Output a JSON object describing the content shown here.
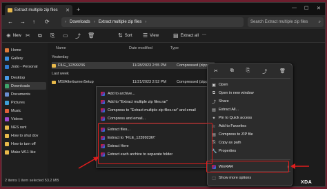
{
  "window": {
    "tab_title": "Extract multiple zip files",
    "tab_close": "✕",
    "new_tab": "+",
    "minimize": "—",
    "maximize": "☐",
    "close": "✕"
  },
  "address": {
    "back": "←",
    "forward": "→",
    "up": "↑",
    "refresh": "⟳",
    "crumbs": [
      "Downloads",
      "Extract multiple zip files"
    ],
    "sep": "›",
    "more": "⋯",
    "search_placeholder": "Search Extract multiple zip files",
    "search_icon": "⌕"
  },
  "toolbar": {
    "new_label": "New",
    "sort_label": "Sort",
    "view_label": "View",
    "extract_all_label": "Extract all",
    "more": "⋯"
  },
  "sidebar": {
    "items": [
      {
        "label": "Home",
        "color": "#e07a3a"
      },
      {
        "label": "Gallery",
        "color": "#3a8ee0"
      },
      {
        "label": "Jodo - Personal",
        "color": "#2f7ad0"
      },
      {
        "label": "Desktop",
        "color": "#4a9be8"
      },
      {
        "label": "Downloads",
        "color": "#3fa46a",
        "active": true
      },
      {
        "label": "Documents",
        "color": "#6a8fd0"
      },
      {
        "label": "Pictures",
        "color": "#3ea0d8"
      },
      {
        "label": "Music",
        "color": "#e0603a"
      },
      {
        "label": "Videos",
        "color": "#a04ad0"
      },
      {
        "label": "NES rant",
        "color": "#e8b94a"
      },
      {
        "label": "How to shut dov",
        "color": "#e8b94a"
      },
      {
        "label": "How to turn off",
        "color": "#e8b94a"
      },
      {
        "label": "Make W11 like",
        "color": "#e8b94a"
      }
    ]
  },
  "content": {
    "col_name": "Name",
    "col_date": "Date modified",
    "col_type": "Type",
    "group_yesterday": "Yesterday",
    "group_lastweek": "Last week",
    "files": [
      {
        "name": "FILE_12399236",
        "date": "11/28/2023 2:55 PM",
        "type": "Compressed (zipp"
      },
      {
        "name": "MSIAfterburnerSetup",
        "date": "11/21/2023 2:52 PM",
        "type": "Compressed (zipp"
      }
    ]
  },
  "status": "2 items   1 item selected  53.2 MB",
  "classic_menu": {
    "items": [
      "Add to archive...",
      "Add to \"Extract multiple zip files.rar\"",
      "Compress to \"Extract multiple zip files.rar\" and email",
      "Compress and email...",
      "Extract files...",
      "Extract to \"FILE_12399236\\\"",
      "Extract Here",
      "Extract each archive to separate folder"
    ]
  },
  "modern_menu": {
    "top_icons": [
      "✂",
      "⧉",
      "⎘",
      "⤴",
      "🗑"
    ],
    "items": [
      {
        "label": "Open",
        "icon": "▣"
      },
      {
        "label": "Open in new window",
        "icon": "⧉"
      },
      {
        "label": "Share",
        "icon": "⤴"
      },
      {
        "label": "Extract All...",
        "icon": "▤"
      },
      {
        "label": "Pin to Quick access",
        "icon": "✦"
      },
      {
        "label": "Add to Favorites",
        "icon": "☆"
      },
      {
        "label": "Compress to ZIP file",
        "icon": "▤"
      },
      {
        "label": "Copy as path",
        "icon": "⎘"
      },
      {
        "label": "Properties",
        "icon": "🔧"
      },
      {
        "label": "WinRAR",
        "icon": "",
        "arrow": "›"
      },
      {
        "label": "Show more options",
        "icon": "⬚"
      }
    ]
  },
  "watermark": "XDA",
  "colors": {
    "highlight": "#e01d1d",
    "accent": "#e8b94a"
  }
}
